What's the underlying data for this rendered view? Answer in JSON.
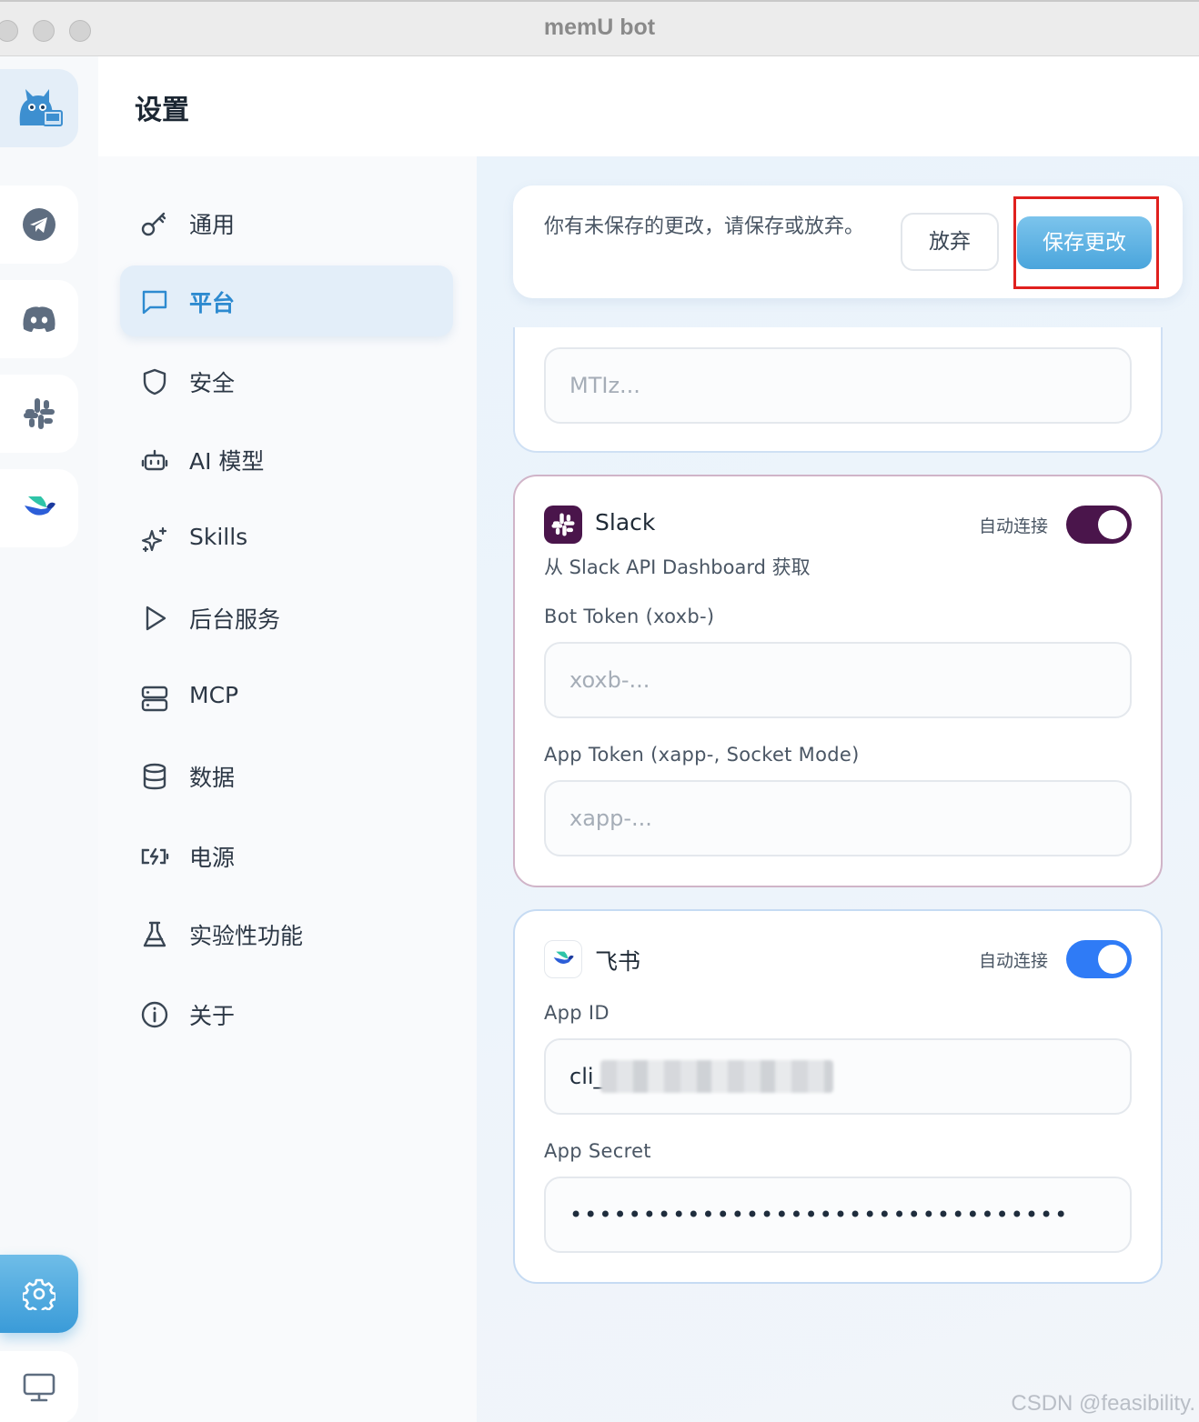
{
  "window": {
    "title": "memU bot"
  },
  "header": {
    "title": "设置"
  },
  "nav": {
    "items": [
      {
        "label": "通用",
        "icon": "key-icon",
        "active": false
      },
      {
        "label": "平台",
        "icon": "message-square-icon",
        "active": true
      },
      {
        "label": "安全",
        "icon": "shield-icon",
        "active": false
      },
      {
        "label": "AI 模型",
        "icon": "bot-icon",
        "active": false
      },
      {
        "label": "Skills",
        "icon": "sparkles-icon",
        "active": false
      },
      {
        "label": "后台服务",
        "icon": "play-icon",
        "active": false
      },
      {
        "label": "MCP",
        "icon": "server-icon",
        "active": false
      },
      {
        "label": "数据",
        "icon": "database-icon",
        "active": false
      },
      {
        "label": "电源",
        "icon": "battery-charging-icon",
        "active": false
      },
      {
        "label": "实验性功能",
        "icon": "flask-icon",
        "active": false
      },
      {
        "label": "关于",
        "icon": "info-icon",
        "active": false
      }
    ]
  },
  "rail": {
    "items": [
      "memu-logo-icon",
      "telegram-icon",
      "discord-icon",
      "slack-icon",
      "feishu-icon",
      "settings-icon",
      "monitor-icon"
    ]
  },
  "unsaved": {
    "message": "你有未保存的更改，请保存或放弃。",
    "discard_label": "放弃",
    "save_label": "保存更改"
  },
  "previous_card": {
    "field_placeholder": "MTIz..."
  },
  "slack": {
    "title": "Slack",
    "auto_connect_label": "自动连接",
    "auto_connect": true,
    "subtitle": "从 Slack API Dashboard 获取",
    "bot_token_label": "Bot Token (xoxb-)",
    "bot_token_placeholder": "xoxb-...",
    "app_token_label": "App Token (xapp-, Socket Mode)",
    "app_token_placeholder": "xapp-...",
    "color": "#4a154b"
  },
  "feishu": {
    "title": "飞书",
    "auto_connect_label": "自动连接",
    "auto_connect": true,
    "app_id_label": "App ID",
    "app_id_value": "cli_",
    "app_secret_label": "App Secret",
    "app_secret_value": "••••••••••••••••••••••••••••••••••",
    "color": "#2f7bf6"
  },
  "colors": {
    "accent": "#3a9bd8",
    "active_nav_bg": "#e3eef9",
    "highlight": "#e0201e"
  },
  "watermark": "CSDN @feasibility."
}
